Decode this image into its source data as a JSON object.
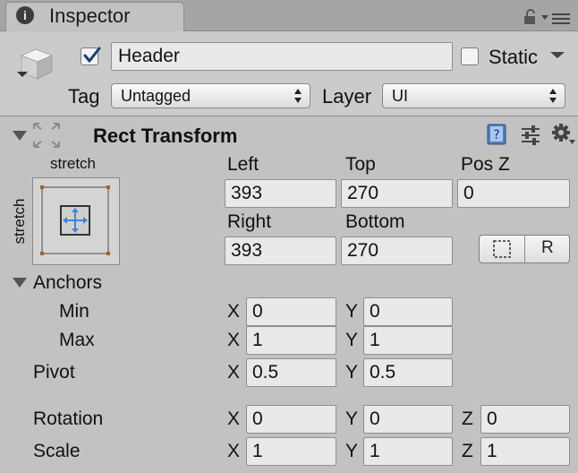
{
  "window": {
    "tab_title": "Inspector",
    "tab_icon_glyph": "i"
  },
  "gameobject": {
    "active": true,
    "name": "Header",
    "static_label": "Static",
    "static_checked": false,
    "tag_label": "Tag",
    "tag_value": "Untagged",
    "layer_label": "Layer",
    "layer_value": "UI"
  },
  "rect_transform": {
    "title": "Rect Transform",
    "anchor_preset_top_label": "stretch",
    "anchor_preset_side_label": "stretch",
    "col_labels": [
      "Left",
      "Top",
      "Pos Z",
      "Right",
      "Bottom"
    ],
    "left": "393",
    "top": "270",
    "pos_z": "0",
    "right": "393",
    "bottom": "270",
    "anchors": {
      "label": "Anchors",
      "min_label": "Min",
      "max_label": "Max",
      "min_x": "0",
      "min_y": "0",
      "max_x": "1",
      "max_y": "1"
    },
    "pivot": {
      "label": "Pivot",
      "x": "0.5",
      "y": "0.5"
    },
    "rotation": {
      "label": "Rotation",
      "x": "0",
      "y": "0",
      "z": "0"
    },
    "scale": {
      "label": "Scale",
      "x": "1",
      "y": "1",
      "z": "1"
    },
    "axis_x": "X",
    "axis_y": "Y",
    "axis_z": "Z",
    "raw_edit_glyph": "R"
  },
  "colors": {
    "panel_bg": "#c2c2c2",
    "anchor_blue": "#3b86d9",
    "anchor_corner": "#a0642a"
  }
}
